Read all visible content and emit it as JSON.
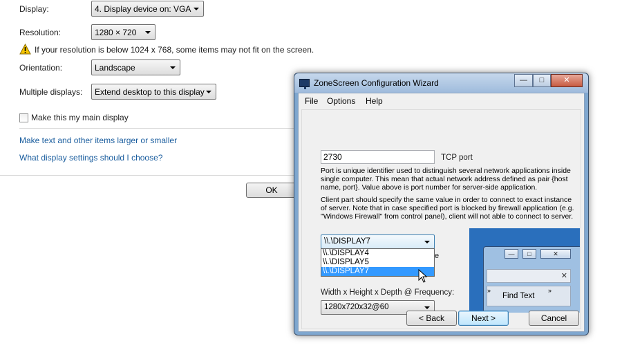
{
  "display": {
    "label": "Display:",
    "value": "4. Display device on: VGA"
  },
  "resolution": {
    "label": "Resolution:",
    "value": "1280 × 720"
  },
  "warning": {
    "text": "If your resolution is below 1024 x 768, some items may not fit on the screen."
  },
  "orientation": {
    "label": "Orientation:",
    "value": "Landscape"
  },
  "multiple": {
    "label": "Multiple displays:",
    "value": "Extend desktop to this display"
  },
  "main_display": {
    "label": "Make this my main display",
    "checked": false
  },
  "links": {
    "text_size": "Make text and other items larger or smaller",
    "which_settings": "What display settings should I choose?"
  },
  "ok_button": "OK",
  "wizard": {
    "title": "ZoneScreen Configuration Wizard",
    "menu": [
      "File",
      "Options",
      "Help"
    ],
    "port_value": "2730",
    "port_label": "TCP port",
    "desc1": "Port is unique identifier used to distinguish several network applications inside single computer. This mean that actual network address defined as pair {host name, port}. Value above is port number for server-side application.",
    "desc2": "Client part should specify the same value in order to connect to exact instance of server. Note that in case specified port is blocked by firewall application (e.g. \"Windows Firewall\" from control panel), client will not able to connect to server.",
    "device_selected": "\\\\.\\DISPLAY7",
    "device_options": [
      "\\\\.\\DISPLAY4",
      "\\\\.\\DISPLAY5",
      "\\\\.\\DISPLAY7"
    ],
    "mode_label": "Width x Height x Depth @ Frequency:",
    "mode_value": "1280x720x32@60",
    "preview_find_text": "Find Text",
    "back": "< Back",
    "next": "Next >",
    "cancel": "Cancel"
  }
}
